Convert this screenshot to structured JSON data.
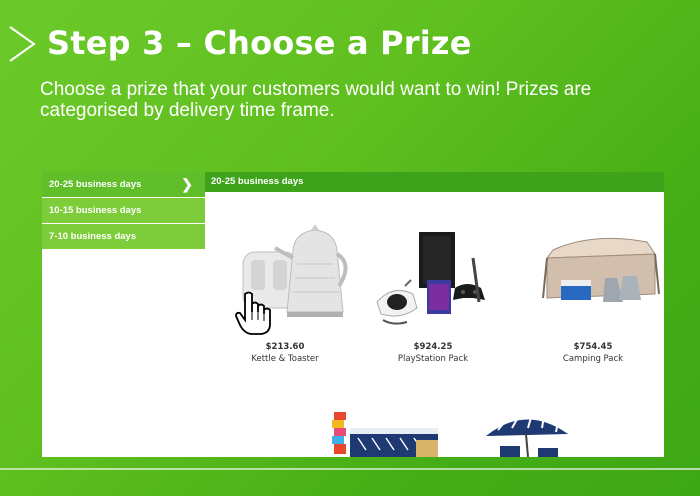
{
  "header": {
    "title": "Step 3 – Choose a Prize",
    "subtitle": "Choose a prize that your customers would want to win! Prizes are categorised by delivery time frame."
  },
  "sidebar": {
    "items": [
      {
        "label": "20-25 business days",
        "active": true
      },
      {
        "label": "10-15 business days",
        "active": false
      },
      {
        "label": "7-10 business days",
        "active": false
      }
    ]
  },
  "content": {
    "header_label": "20-25 business days",
    "products": [
      {
        "price": "$213.60",
        "name": "Kettle & Toaster"
      },
      {
        "price": "$924.25",
        "name": "PlayStation Pack"
      },
      {
        "price": "$754.45",
        "name": "Camping Pack"
      }
    ]
  },
  "colors": {
    "accent_green": "#3ea31b",
    "sidebar_green": "#7dcc3a"
  }
}
